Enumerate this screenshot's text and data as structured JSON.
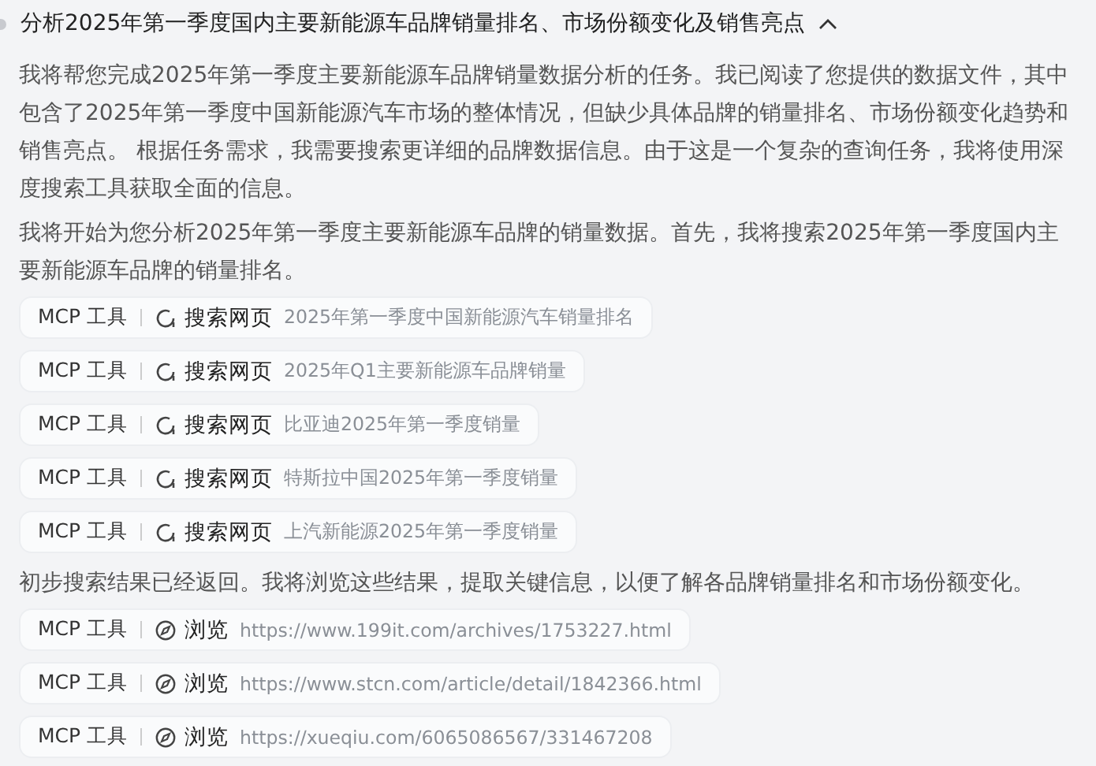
{
  "title": "分析2025年第一季度国内主要新能源车品牌销量排名、市场份额变化及销售亮点",
  "expanded": true,
  "blocks": [
    {
      "kind": "text",
      "text": "我将帮您完成2025年第一季度主要新能源车品牌销量数据分析的任务。我已阅读了您提供的数据文件，其中包含了2025年第一季度中国新能源汽车市场的整体情况，但缺少具体品牌的销量排名、市场份额变化趋势和销售亮点。 根据任务需求，我需要搜索更详细的品牌数据信息。由于这是一个复杂的查询任务，我将使用深度搜索工具获取全面的信息。"
    },
    {
      "kind": "text",
      "text": "我将开始为您分析2025年第一季度主要新能源车品牌的销量数据。首先，我将搜索2025年第一季度国内主要新能源车品牌的销量排名。"
    },
    {
      "kind": "search",
      "tool": "MCP 工具",
      "action": "搜索网页",
      "arg": "2025年第一季度中国新能源汽车销量排名"
    },
    {
      "kind": "search",
      "tool": "MCP 工具",
      "action": "搜索网页",
      "arg": "2025年Q1主要新能源车品牌销量"
    },
    {
      "kind": "search",
      "tool": "MCP 工具",
      "action": "搜索网页",
      "arg": "比亚迪2025年第一季度销量"
    },
    {
      "kind": "search",
      "tool": "MCP 工具",
      "action": "搜索网页",
      "arg": "特斯拉中国2025年第一季度销量"
    },
    {
      "kind": "search",
      "tool": "MCP 工具",
      "action": "搜索网页",
      "arg": "上汽新能源2025年第一季度销量"
    },
    {
      "kind": "text",
      "text": "初步搜索结果已经返回。我将浏览这些结果，提取关键信息，以便了解各品牌销量排名和市场份额变化。"
    },
    {
      "kind": "browse",
      "tool": "MCP 工具",
      "action": "浏览",
      "arg": "https://www.199it.com/archives/1753227.html"
    },
    {
      "kind": "browse",
      "tool": "MCP 工具",
      "action": "浏览",
      "arg": "https://www.stcn.com/article/detail/1842366.html"
    },
    {
      "kind": "browse",
      "tool": "MCP 工具",
      "action": "浏览",
      "arg": "https://xueqiu.com/6065086567/331467208"
    }
  ]
}
